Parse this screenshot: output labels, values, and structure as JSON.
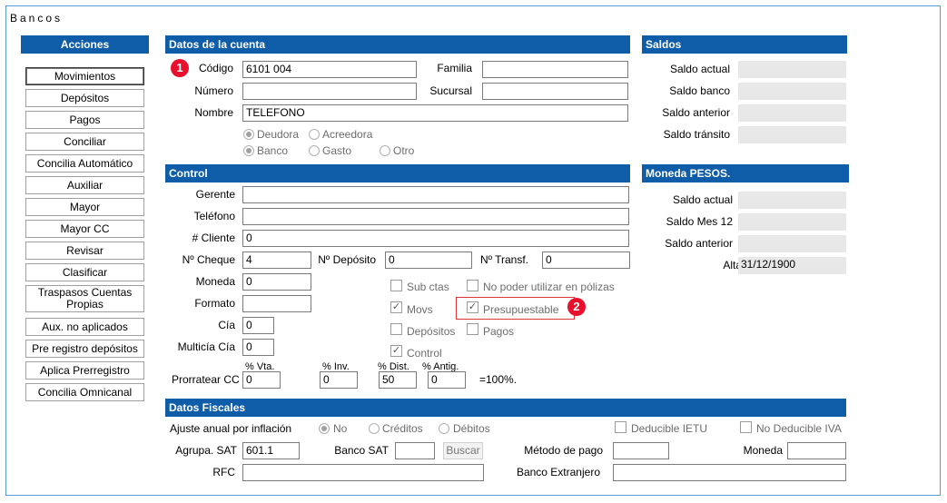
{
  "window": {
    "title": "Bancos"
  },
  "sections": {
    "acciones": "Acciones",
    "datos_cuenta": "Datos de la cuenta",
    "saldos": "Saldos",
    "control": "Control",
    "moneda": "Moneda PESOS.",
    "fiscales": "Datos Fiscales"
  },
  "acciones": [
    "Movimientos",
    "Depósitos",
    "Pagos",
    "Conciliar",
    "Concilia Automático",
    "Auxiliar",
    "Mayor",
    "Mayor CC",
    "Revisar",
    "Clasificar",
    "Traspasos  Cuentas Propias",
    "Aux. no aplicados",
    "Pre registro depósitos",
    "Aplica Prerregistro",
    "Concilia Omnicanal"
  ],
  "cuenta": {
    "codigo_label": "Código",
    "codigo": "6101 004",
    "familia_label": "Familia",
    "familia": "",
    "numero_label": "Número",
    "numero": "",
    "sucursal_label": "Sucursal",
    "sucursal": "",
    "nombre_label": "Nombre",
    "nombre": "TELEFONO",
    "naturaleza": [
      "Deudora",
      "Acreedora"
    ],
    "tipo": [
      "Banco",
      "Gasto",
      "Otro"
    ]
  },
  "saldos": {
    "labels": [
      "Saldo actual",
      "Saldo banco",
      "Saldo anterior",
      "Saldo tránsito"
    ]
  },
  "control": {
    "gerente_label": "Gerente",
    "gerente": "",
    "telefono_label": "Teléfono",
    "telefono": "",
    "cliente_label": "# Cliente",
    "cliente": "0",
    "cheque_label": "Nº Cheque",
    "cheque": "4",
    "deposito_label": "Nº Depósito",
    "deposito": "0",
    "transf_label": "Nº Transf.",
    "transf": "0",
    "moneda_label": "Moneda",
    "moneda": "0",
    "formato_label": "Formato",
    "formato": "",
    "cia_label": "Cía",
    "cia": "0",
    "multicia_label": "Multicía Cía",
    "multicia": "0",
    "prorratear_label": "Prorratear CC",
    "vta_label": "% Vta.",
    "vta": "0",
    "inv_label": "% Inv.",
    "inv": "0",
    "dist_label": "% Dist.",
    "dist": "50",
    "antig_label": "% Antig.",
    "antig": "0",
    "total_label": "=100%.",
    "sub_ctas": "Sub ctas",
    "no_polizas": "No poder utilizar en pólizas",
    "movs": "Movs",
    "presupuestable": "Presupuestable",
    "depositos": "Depósitos",
    "pagos": "Pagos",
    "control_chk": "Control"
  },
  "moneda": {
    "labels": [
      "Saldo actual",
      "Saldo Mes 12",
      "Saldo anterior",
      "Alta"
    ],
    "alta": "31/12/1900"
  },
  "fiscales": {
    "ajuste_label": "Ajuste anual por inflación",
    "ajuste_opts": [
      "No",
      "Créditos",
      "Débitos"
    ],
    "ietu": "Deducible IETU",
    "no_iva": "No Deducible IVA",
    "agrupa_label": "Agrupa. SAT",
    "agrupa": "601.1",
    "banco_sat_label": "Banco SAT",
    "banco_sat": "",
    "buscar": "Buscar",
    "metodo_label": "Método de pago",
    "metodo": "",
    "moneda_label": "Moneda",
    "moneda": "",
    "rfc_label": "RFC",
    "rfc": "",
    "banco_ext_label": "Banco Extranjero",
    "banco_ext": ""
  },
  "badges": [
    "1",
    "2"
  ]
}
